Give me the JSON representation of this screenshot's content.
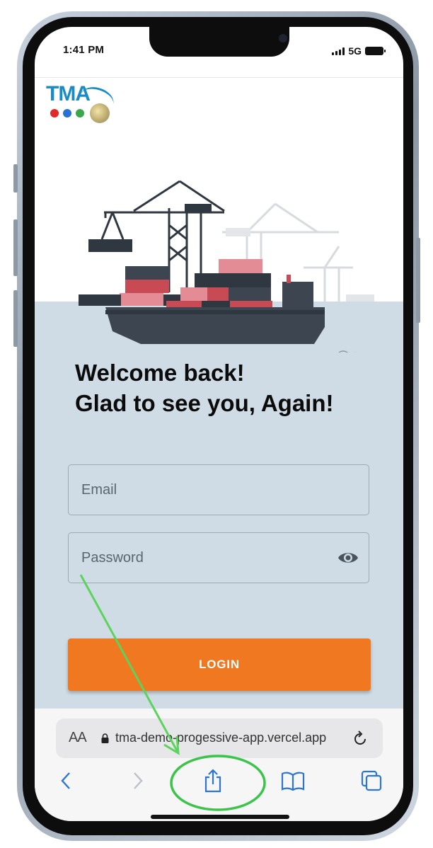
{
  "status_bar": {
    "time": "1:41 PM",
    "network": "5G"
  },
  "logo": {
    "text": "TMA",
    "dot_colors": [
      "#e02a2a",
      "#2a6fd6",
      "#3aa84a"
    ]
  },
  "welcome": {
    "line1": "Welcome back!",
    "line2": "Glad to see you, Again!"
  },
  "form": {
    "email_placeholder": "Email",
    "password_placeholder": "Password",
    "login_label": "LOGIN"
  },
  "browser": {
    "text_size_label": "AA",
    "url": "tma-demo-progessive-app.vercel.app"
  },
  "colors": {
    "accent": "#f07820",
    "sea": "#cfdce5",
    "annotation": "#5cd35c"
  }
}
